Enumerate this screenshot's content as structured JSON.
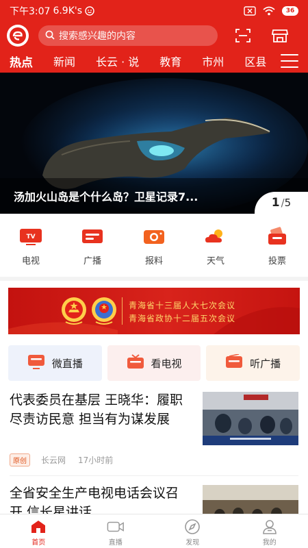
{
  "status_bar": {
    "time": "下午3:07",
    "speed": "6.9K's",
    "battery": "36"
  },
  "colors": {
    "brand_red": "#e2231a",
    "tag_orange": "#e0541c"
  },
  "search": {
    "placeholder": "搜索感兴趣的内容"
  },
  "header_icons": {
    "logo": "app-logo-icon",
    "scan": "scan-icon",
    "shop": "shop-icon",
    "menu": "menu-icon"
  },
  "tabs": [
    {
      "label": "热点",
      "active": true
    },
    {
      "label": "新闻"
    },
    {
      "label": "长云 · 说"
    },
    {
      "label": "教育"
    },
    {
      "label": "市州"
    },
    {
      "label": "区县"
    }
  ],
  "banner": {
    "title": "汤加火山岛是个什么岛？卫星记录7...",
    "pager_current": "1",
    "pager_total": "5"
  },
  "quick_links": [
    {
      "label": "电视",
      "icon": "tv-icon"
    },
    {
      "label": "广播",
      "icon": "radio-icon"
    },
    {
      "label": "报料",
      "icon": "camera-icon"
    },
    {
      "label": "天气",
      "icon": "weather-icon"
    },
    {
      "label": "投票",
      "icon": "vote-icon"
    }
  ],
  "promo": {
    "line1": "青海省十三届人大七次会议",
    "line2": "青海省政协十二届五次会议"
  },
  "channels": [
    {
      "label": "微直播",
      "icon": "monitor-icon"
    },
    {
      "label": "看电视",
      "icon": "tv-icon"
    },
    {
      "label": "听广播",
      "icon": "radio-icon"
    }
  ],
  "articles": [
    {
      "title": "代表委员在基层 王晓华：履职尽责访民意 担当有为谋发展",
      "tag": "原创",
      "source": "长云网",
      "time": "17小时前"
    },
    {
      "title": "全省安全生产电视电话会议召开 信长星讲话"
    }
  ],
  "bottom_nav": [
    {
      "label": "首页",
      "icon": "home-icon",
      "active": true
    },
    {
      "label": "直播",
      "icon": "video-icon"
    },
    {
      "label": "发现",
      "icon": "compass-icon"
    },
    {
      "label": "我的",
      "icon": "user-icon"
    }
  ]
}
